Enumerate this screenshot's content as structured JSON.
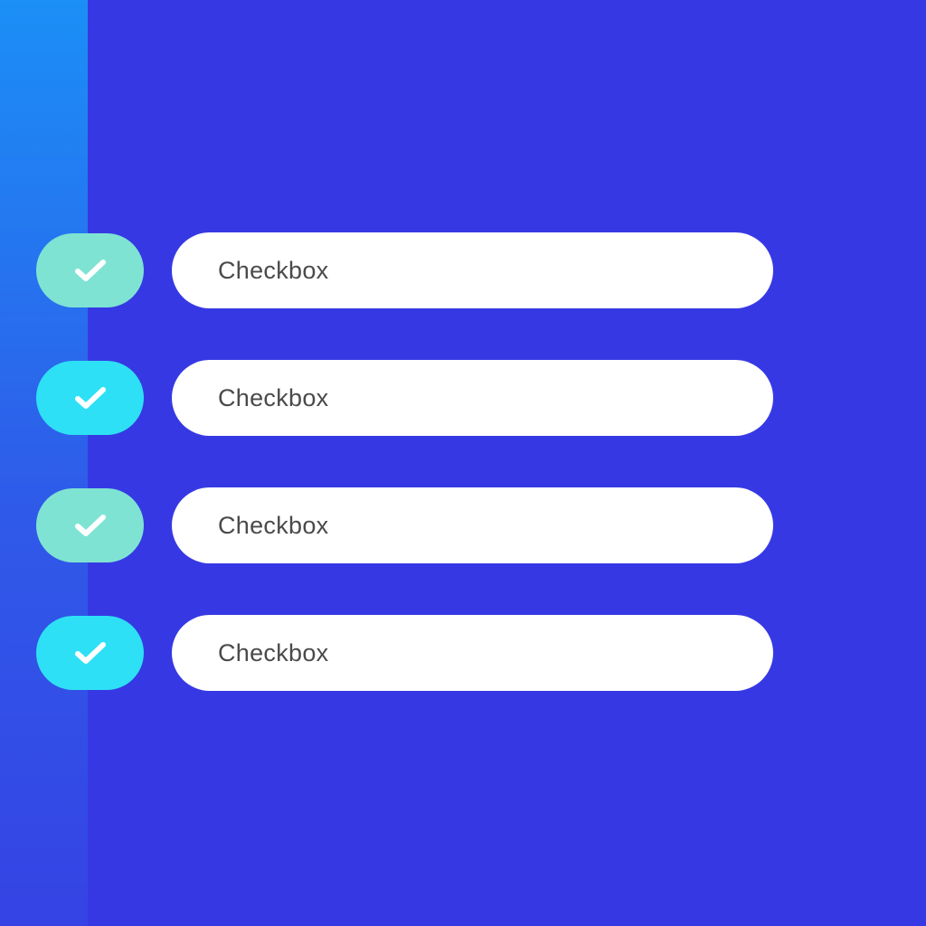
{
  "theme": {
    "background": "#3639e3",
    "strip_top": "#1b8ff6",
    "strip_bottom": "#3543e4",
    "pill_background": "#ffffff",
    "label_color": "#4a4a4a",
    "check_color": "#ffffff"
  },
  "checkboxes": [
    {
      "label": "Checkbox",
      "checked": true,
      "color": "#7fe3d3",
      "icon": "check-icon"
    },
    {
      "label": "Checkbox",
      "checked": true,
      "color": "#2ee0f5",
      "icon": "check-icon"
    },
    {
      "label": "Checkbox",
      "checked": true,
      "color": "#7fe3d3",
      "icon": "check-icon"
    },
    {
      "label": "Checkbox",
      "checked": true,
      "color": "#2ee0f5",
      "icon": "check-icon"
    }
  ]
}
